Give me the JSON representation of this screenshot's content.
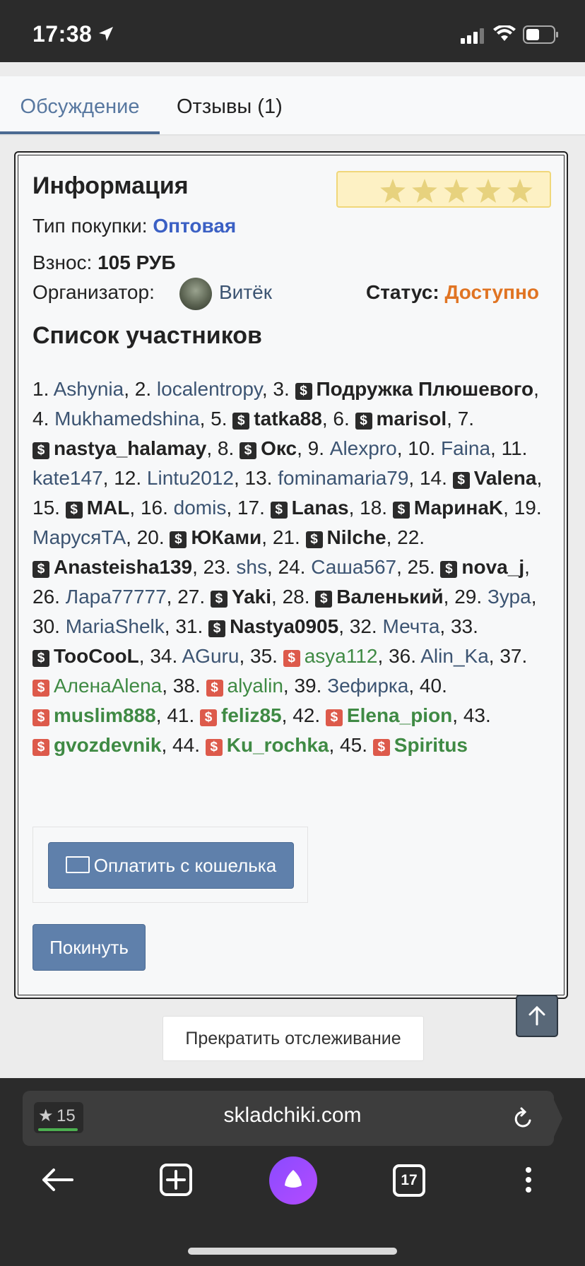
{
  "status_bar": {
    "time": "17:38"
  },
  "tabs": [
    {
      "label": "Обсуждение"
    },
    {
      "label": "Отзывы (1)"
    }
  ],
  "info": {
    "title": "Информация",
    "purchase_type_label": "Тип покупки:",
    "purchase_type_value": "Оптовая",
    "fee_label": "Взнос:",
    "fee_value": "105 РУБ",
    "organizer_label": "Организатор:",
    "organizer_name": "Витёк",
    "status_label": "Статус:",
    "status_value": "Доступно",
    "rating_stars": 5
  },
  "members_title": "Список участников",
  "members": [
    {
      "n": "1.",
      "name": "Ashynia",
      "style": "plain"
    },
    {
      "n": "2.",
      "name": "localentropy",
      "style": "plain"
    },
    {
      "n": "3.",
      "name": "Подружка Плюшевого",
      "style": "paid"
    },
    {
      "n": "4.",
      "name": "Mukhamedshina",
      "style": "plain"
    },
    {
      "n": "5.",
      "name": "tatka88",
      "style": "paid"
    },
    {
      "n": "6.",
      "name": "marisol",
      "style": "paid"
    },
    {
      "n": "7.",
      "name": "nastya_halamay",
      "style": "paid"
    },
    {
      "n": "8.",
      "name": "Окс",
      "style": "paid"
    },
    {
      "n": "9.",
      "name": "Alexpro",
      "style": "plain"
    },
    {
      "n": "10.",
      "name": "Faina",
      "style": "plain"
    },
    {
      "n": "11.",
      "name": "kate147",
      "style": "plain"
    },
    {
      "n": "12.",
      "name": "Lintu2012",
      "style": "plain"
    },
    {
      "n": "13.",
      "name": "fominamaria79",
      "style": "plain"
    },
    {
      "n": "14.",
      "name": "Valena",
      "style": "paid"
    },
    {
      "n": "15.",
      "name": "MAL",
      "style": "paid"
    },
    {
      "n": "16.",
      "name": "domis",
      "style": "plain"
    },
    {
      "n": "17.",
      "name": "Lanas",
      "style": "paid"
    },
    {
      "n": "18.",
      "name": "МаринаK",
      "style": "paid"
    },
    {
      "n": "19.",
      "name": "МарусяТА",
      "style": "plain"
    },
    {
      "n": "20.",
      "name": "ЮКами",
      "style": "paid"
    },
    {
      "n": "21.",
      "name": "Nilche",
      "style": "paid"
    },
    {
      "n": "22.",
      "name": "Anasteisha139",
      "style": "paid"
    },
    {
      "n": "23.",
      "name": "shs",
      "style": "plain"
    },
    {
      "n": "24.",
      "name": "Саша567",
      "style": "plain"
    },
    {
      "n": "25.",
      "name": "nova_j",
      "style": "paid"
    },
    {
      "n": "26.",
      "name": "Лара77777",
      "style": "plain"
    },
    {
      "n": "27.",
      "name": "Yaki",
      "style": "paid"
    },
    {
      "n": "28.",
      "name": "Валенький",
      "style": "paid"
    },
    {
      "n": "29.",
      "name": "Зура",
      "style": "plain"
    },
    {
      "n": "30.",
      "name": "MariaShelk",
      "style": "plain"
    },
    {
      "n": "31.",
      "name": "Nastya0905",
      "style": "paid"
    },
    {
      "n": "32.",
      "name": "Мечта",
      "style": "plain"
    },
    {
      "n": "33.",
      "name": "TooCooL",
      "style": "paid"
    },
    {
      "n": "34.",
      "name": "AGuru",
      "style": "plain"
    },
    {
      "n": "35.",
      "name": "asya112",
      "style": "red"
    },
    {
      "n": "36.",
      "name": "Alin_Ka",
      "style": "plain"
    },
    {
      "n": "37.",
      "name": "АленаAlena",
      "style": "red"
    },
    {
      "n": "38.",
      "name": "alyalin",
      "style": "red"
    },
    {
      "n": "39.",
      "name": "Зефирка",
      "style": "plain"
    },
    {
      "n": "40.",
      "name": "muslim888",
      "style": "redbold"
    },
    {
      "n": "41.",
      "name": "feliz85",
      "style": "redbold"
    },
    {
      "n": "42.",
      "name": "Elena_pion",
      "style": "redbold"
    },
    {
      "n": "43.",
      "name": "gvozdevnik",
      "style": "redbold"
    },
    {
      "n": "44.",
      "name": "Ku_rochka",
      "style": "redbold"
    },
    {
      "n": "45.",
      "name": "Spiritus",
      "style": "redbold"
    }
  ],
  "buttons": {
    "pay_wallet": "Оплатить с кошелька",
    "leave": "Покинуть",
    "stop_tracking": "Прекратить отслеживание"
  },
  "browser": {
    "badge_count": "15",
    "url": "skladchiki.com",
    "tabs_count": "17"
  },
  "colors": {
    "accent": "#5f80ab",
    "link": "#3c5472",
    "green": "#3f8a44",
    "orange": "#e07423",
    "blue": "#3b60c4"
  }
}
